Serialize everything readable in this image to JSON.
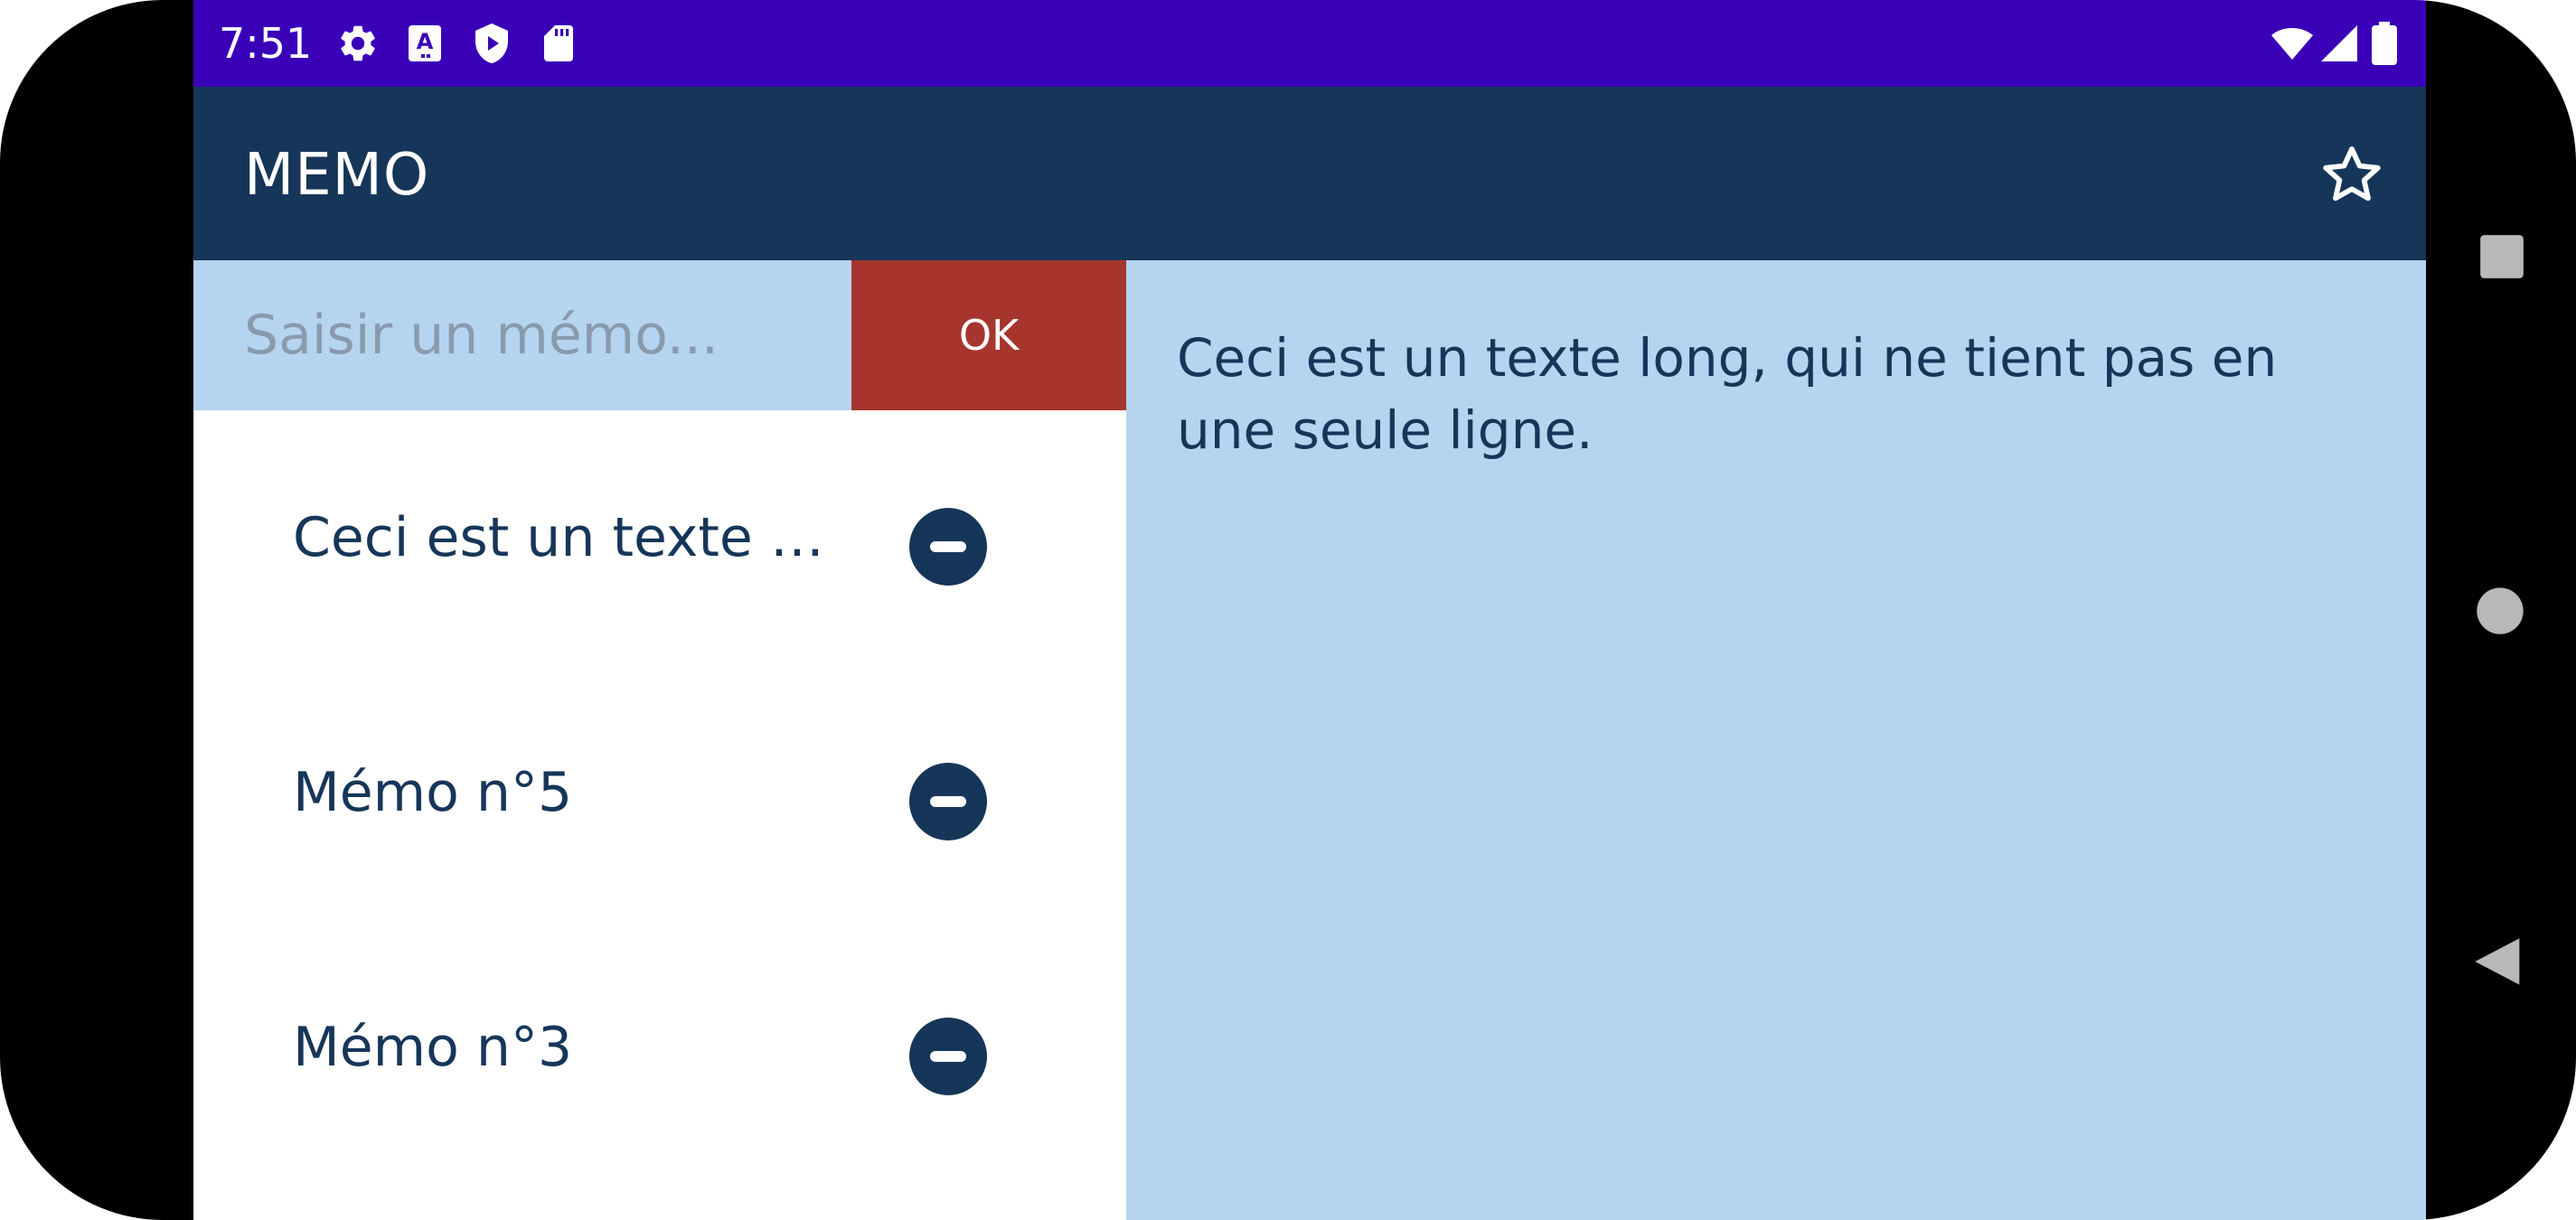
{
  "status_bar": {
    "time": "7:51",
    "icons_left": [
      "settings-icon",
      "text-a-icon",
      "shield-play-icon",
      "sd-card-icon"
    ],
    "icons_right": [
      "wifi-icon",
      "signal-icon",
      "battery-icon"
    ],
    "background": "#3a00b8"
  },
  "app_bar": {
    "title": "MEMO",
    "star_icon": "star-outline-icon",
    "background": "#163659"
  },
  "input": {
    "placeholder": "Saisir un mémo...",
    "value": "",
    "ok_label": "OK",
    "ok_color": "#a6362d"
  },
  "memos": [
    {
      "label": "Ceci est un texte long, qui ne tient pas en une seule ligne.",
      "remove_icon": "remove-circle-icon"
    },
    {
      "label": "Mémo n°5",
      "remove_icon": "remove-circle-icon"
    },
    {
      "label": "Mémo n°3",
      "remove_icon": "remove-circle-icon"
    }
  ],
  "detail": {
    "text": "Ceci est un texte long, qui ne tient pas en une seule ligne.",
    "background": "#b5d4f0"
  },
  "nav_bar": {
    "buttons": [
      "recents-square-icon",
      "home-circle-icon",
      "back-triangle-icon"
    ]
  }
}
